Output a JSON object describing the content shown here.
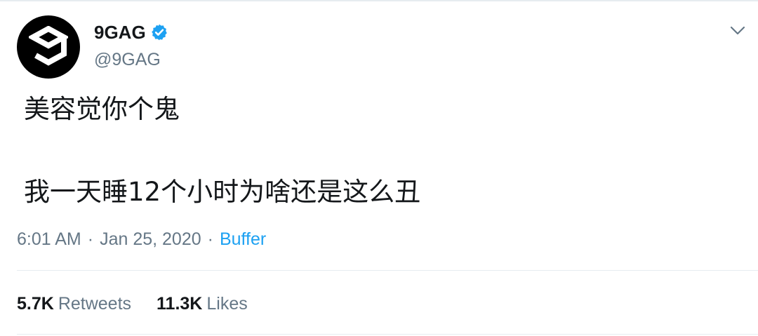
{
  "author": {
    "display_name": "9GAG",
    "handle": "@9GAG",
    "verified": true,
    "avatar_icon": "9gag-logo",
    "avatar_color": "#000000"
  },
  "menu_icon": "chevron-down-icon",
  "tweet": {
    "line1": "美容觉你个鬼",
    "line2": "我一天睡12个小时为啥还是这么丑"
  },
  "meta": {
    "time": "6:01 AM",
    "separator": "·",
    "date": "Jan 25, 2020",
    "source": "Buffer"
  },
  "stats": {
    "retweets_count": "5.7K",
    "retweets_label": "Retweets",
    "likes_count": "11.3K",
    "likes_label": "Likes"
  },
  "colors": {
    "text": "#14171a",
    "secondary": "#657786",
    "accent": "#1da1f2",
    "divider": "#e6ecf0"
  }
}
